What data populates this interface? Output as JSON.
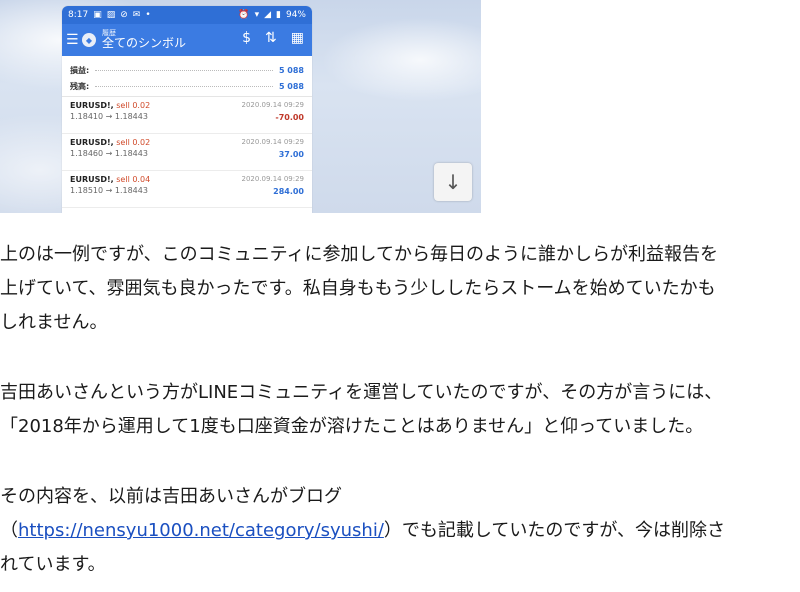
{
  "screenshot": {
    "status": {
      "time": "8:17",
      "icons_left": [
        "message-icon",
        "photo-icon",
        "block-icon",
        "mail-icon",
        "dot-icon"
      ],
      "battery": "94%"
    },
    "app": {
      "subtitle": "履歴",
      "title": "全てのシンボル"
    },
    "summary": [
      {
        "label": "損益:",
        "value": "5 088"
      },
      {
        "label": "残高:",
        "value": "5 088"
      }
    ],
    "trades": [
      {
        "symbol": "EURUSD!,",
        "side": "sell 0.02",
        "prices": "1.18410 → 1.18443",
        "time": "2020.09.14 09:29",
        "pl": "-70.00",
        "sign": "neg"
      },
      {
        "symbol": "EURUSD!,",
        "side": "sell 0.02",
        "prices": "1.18460 → 1.18443",
        "time": "2020.09.14 09:29",
        "pl": "37.00",
        "sign": "pos"
      },
      {
        "symbol": "EURUSD!,",
        "side": "sell 0.04",
        "prices": "1.18510 → 1.18443",
        "time": "2020.09.14 09:29",
        "pl": "284.00",
        "sign": "pos"
      }
    ],
    "scroll_button_icon": "arrow-down-icon"
  },
  "article": {
    "p1_line1": "上のは一例ですが、このコミュニティに参加してから毎日のように誰かしらが利益報告を",
    "p1_line2": "上げていて、雰囲気も良かったです。私自身ももう少ししたらストームを始めていたかも",
    "p1_line3": "しれません。",
    "p2_line1": "吉田あいさんという方がLINEコミュニティを運営していたのですが、その方が言うには、",
    "p2_line2": "「2018年から運用して1度も口座資金が溶けたことはありません」と仰っていました。",
    "p3_line1": "その内容を、以前は吉田あいさんがブログ",
    "p3_open": "（",
    "p3_link": "https://nensyu1000.net/category/syushi/",
    "p3_after": "）でも記載していたのですが、今は削除さ",
    "p3_line3": "れています。"
  },
  "colors": {
    "app_bar": "#3b7be2",
    "status_bar": "#2f6fd6",
    "loss": "#c0392b",
    "profit": "#2f6fd6",
    "link": "#1a4fc0"
  }
}
